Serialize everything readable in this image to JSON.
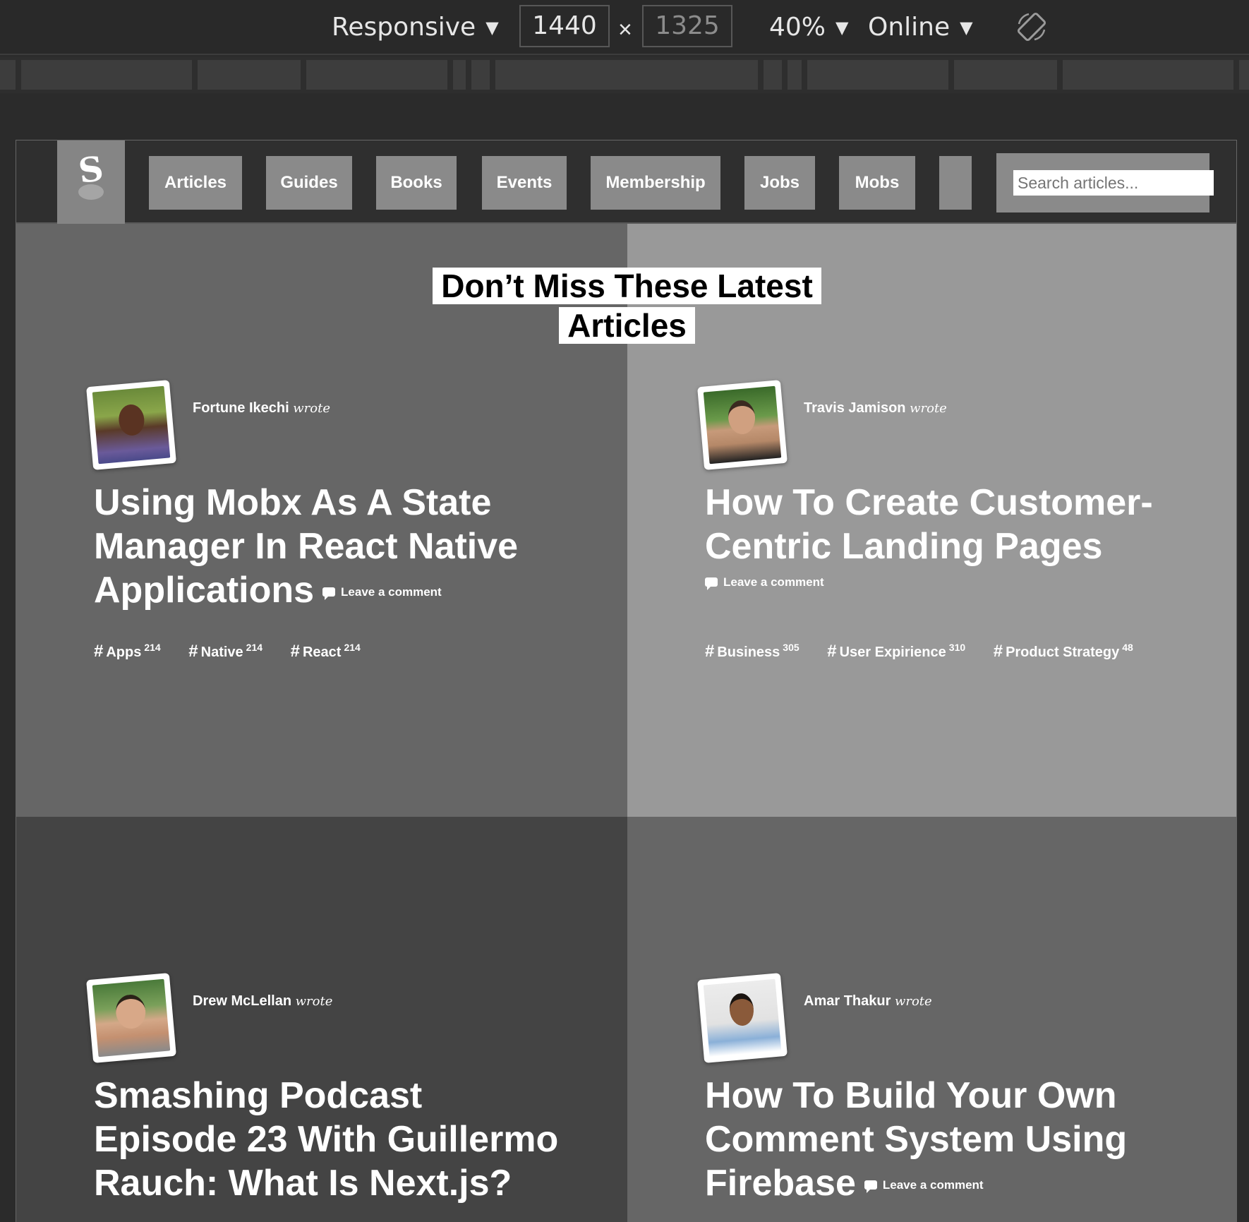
{
  "devtools": {
    "device": "Responsive",
    "width": "1440",
    "height": "1325",
    "times": "×",
    "zoom": "40%",
    "network": "Online",
    "dropdown_arrow": "▼"
  },
  "site": {
    "logo": "S",
    "nav": [
      "Articles",
      "Guides",
      "Books",
      "Events",
      "Membership",
      "Jobs",
      "Mobs",
      ""
    ],
    "search_placeholder": "Search articles...",
    "section_title_line1": "Don’t Miss These Latest",
    "section_title_line2": "Articles"
  },
  "articles": [
    {
      "author": "Fortune Ikechi",
      "wrote": "wrote",
      "title": "Using Mobx As A State Manager In React Native Applications",
      "comment": "Leave a comment",
      "tags": [
        {
          "name": "Apps",
          "count": "214"
        },
        {
          "name": "Native",
          "count": "214"
        },
        {
          "name": "React",
          "count": "214"
        }
      ]
    },
    {
      "author": "Travis Jamison",
      "wrote": "wrote",
      "title": "How To Create Customer-Centric Landing Pages",
      "comment": "Leave a comment",
      "tags": [
        {
          "name": "Business",
          "count": "305"
        },
        {
          "name": "User Expirience",
          "count": "310"
        },
        {
          "name": "Product Strategy",
          "count": "48"
        }
      ]
    },
    {
      "author": "Drew McLellan",
      "wrote": "wrote",
      "title": "Smashing Podcast Episode 23 With Guillermo Rauch: What Is Next.js?",
      "comment": "",
      "tags": []
    },
    {
      "author": "Amar Thakur",
      "wrote": "wrote",
      "title": "How To Build Your Own Comment System Using Firebase",
      "comment": "Leave a comment",
      "tags": []
    }
  ],
  "colors": {
    "toolbar_bg": "#292929",
    "nav_button": "#8a8a8a",
    "tile_dark": "#444444",
    "tile_mid": "#666666",
    "tile_light": "#999999"
  }
}
